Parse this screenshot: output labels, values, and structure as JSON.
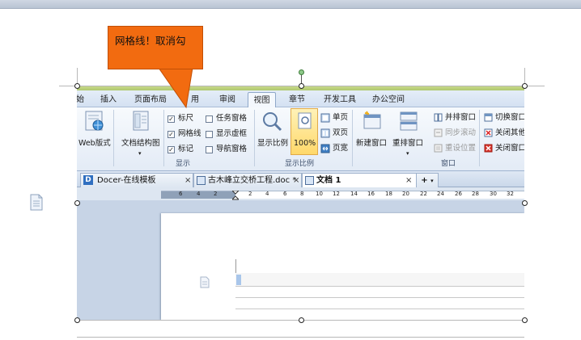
{
  "callout": {
    "text": "网格线！取消勾"
  },
  "ribbon": {
    "tabs": [
      {
        "label": "始"
      },
      {
        "label": "插入"
      },
      {
        "label": "页面布局"
      },
      {
        "label": "用"
      },
      {
        "label": "审阅"
      },
      {
        "label": "视图",
        "active": true
      },
      {
        "label": "章节"
      },
      {
        "label": "开发工具"
      },
      {
        "label": "办公空间"
      }
    ],
    "web_layout": "Web版式",
    "doc_structure": "文档结构图",
    "show_checks": [
      {
        "label": "标尺",
        "checked": true
      },
      {
        "label": "网格线",
        "checked": true
      },
      {
        "label": "标记",
        "checked": true
      }
    ],
    "show_checks_right": [
      {
        "label": "任务窗格",
        "checked": false
      },
      {
        "label": "显示虚框",
        "checked": false
      },
      {
        "label": "导航窗格",
        "checked": false
      }
    ],
    "group_show": "显示",
    "zoom_label": "显示比例",
    "zoom_100": "100%",
    "page_single": "单页",
    "page_double": "双页",
    "page_width": "页宽",
    "group_zoom": "显示比例",
    "new_window": "新建窗口",
    "arrange_window": "重排窗口",
    "side_by_side": "并排窗口",
    "sync_scroll": "同步滚动",
    "reset_position": "重设位置",
    "switch_window": "切换窗口",
    "close_other": "关闭其他",
    "close_window": "关闭窗口",
    "group_window": "窗口"
  },
  "doc_tabs": [
    {
      "label": "Docer-在线模板"
    },
    {
      "label": "古木峰立交桥工程.doc *"
    },
    {
      "label": "文档 1",
      "active": true
    }
  ],
  "ruler_numbers": [
    "6",
    "4",
    "2",
    "2",
    "4",
    "6",
    "8",
    "10",
    "12",
    "14",
    "16",
    "18",
    "20",
    "22",
    "24",
    "26",
    "28",
    "30",
    "32"
  ],
  "colors": {
    "callout": "#f26b10",
    "ribbon_accent": "#a9c46a",
    "tab_active_border": "#8fa8c9"
  }
}
